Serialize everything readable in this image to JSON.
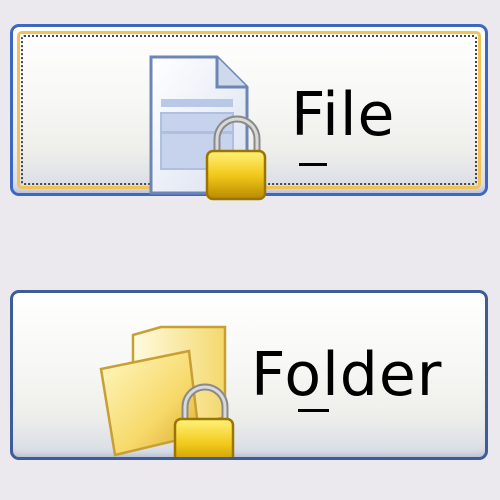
{
  "buttons": [
    {
      "label": "File",
      "mnemonic": "F",
      "icon": "file-lock-icon",
      "focused": true
    },
    {
      "label": "Folder",
      "mnemonic": "o",
      "icon": "folder-lock-icon",
      "focused": false
    }
  ],
  "colors": {
    "border_focused": "#3d66c5",
    "border": "#3e5c95",
    "focus_ring": "#f2c258",
    "background": "#ebe9ed"
  }
}
